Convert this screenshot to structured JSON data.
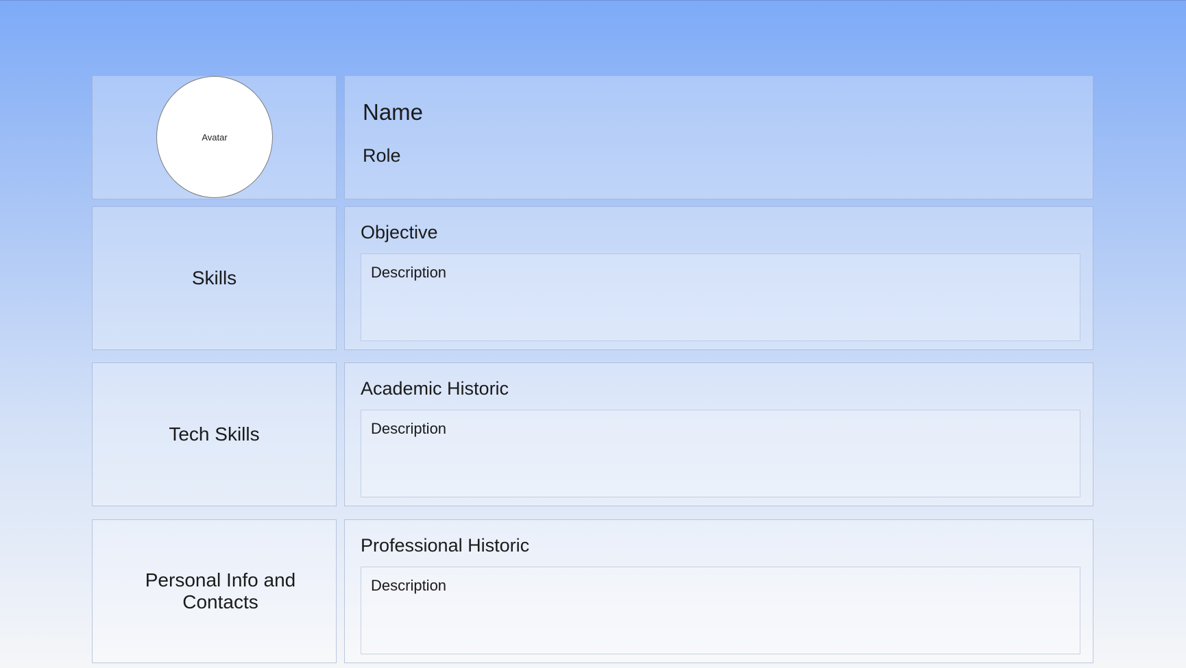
{
  "header": {
    "avatar_label": "Avatar",
    "name": "Name",
    "role": "Role"
  },
  "sidebar": {
    "skills": "Skills",
    "tech_skills": "Tech Skills",
    "personal_info": "Personal Info and Contacts"
  },
  "sections": [
    {
      "title": "Objective",
      "description": "Description"
    },
    {
      "title": "Academic Historic",
      "description": "Description"
    },
    {
      "title": "Professional Historic",
      "description": "Description"
    }
  ]
}
